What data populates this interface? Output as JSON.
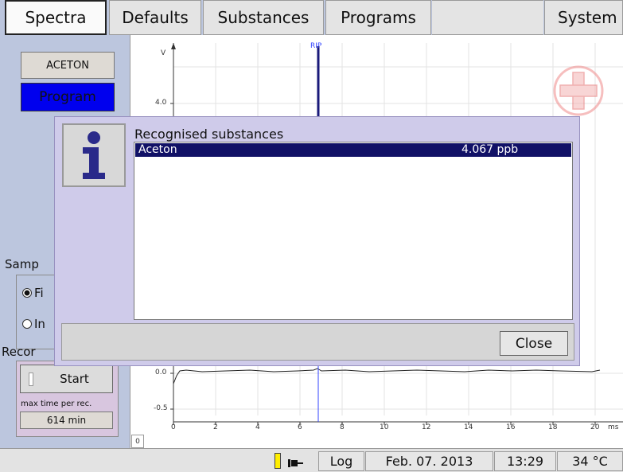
{
  "tabs": {
    "spectra": "Spectra",
    "defaults": "Defaults",
    "substances": "Substances",
    "programs": "Programs",
    "system": "System"
  },
  "left": {
    "substance_button": "ACETON",
    "program_button": "Program",
    "sample_label_partial": "Samp",
    "radio1_partial": "Fi",
    "radio2_partial": "In",
    "record_label_partial": "Recor",
    "start_button": "Start",
    "max_time_label": "max time per rec.",
    "max_time_value": "614 min"
  },
  "chart": {
    "y_axis_label": "V",
    "peak_label": "RIP",
    "y_ticks": [
      "4.0",
      "0.0",
      "-0.5"
    ],
    "x_ticks": [
      "0",
      "2",
      "4",
      "6",
      "8",
      "10",
      "12",
      "14",
      "16",
      "18",
      "20"
    ],
    "x_unit_partial": "ms",
    "corner_value": "0",
    "colors": {
      "peak": "#1a1a7a",
      "marker": "#3344ff",
      "trace": "#222222"
    }
  },
  "dialog": {
    "title": "Recognised substances",
    "rows": [
      {
        "name": "Aceton",
        "value": "4.067 ppb"
      }
    ],
    "close_button": "Close"
  },
  "status": {
    "log_button": "Log",
    "date": "Feb. 07. 2013",
    "time": "13:29",
    "temperature": "34 °C"
  },
  "colors": {
    "background": "#bcc6de",
    "program_button": "#0000ee",
    "dialog_bg": "#cfcbea",
    "selection": "#111166",
    "battery_indicator": "#ffee00"
  }
}
